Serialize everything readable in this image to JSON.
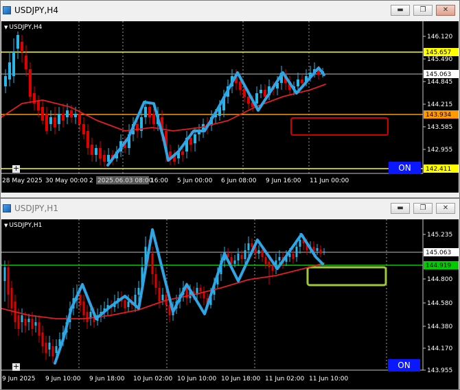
{
  "colors": {
    "bull": "#29b6e8",
    "bear": "#e00000",
    "ma": "#e02020",
    "zigzag": "#2ea6e6",
    "grid": "#c8c8c8",
    "h_yellow": "#ffff00",
    "h_orange": "#ff9900",
    "h_green": "#00cc00",
    "red_box": "#d00000",
    "green_box": "#9ec93c",
    "on_button": "#0b18ff"
  },
  "window_h4": {
    "title": "USDJPY,H4",
    "symbol_label": "USDJPY,H4",
    "on_label": "ON",
    "price_labels": [
      "146.120",
      "145.490",
      "144.845",
      "144.215",
      "143.585",
      "142.955"
    ],
    "marked_prices": [
      {
        "value": "145.657",
        "color": "#ffff00"
      },
      {
        "value": "145.063",
        "color": "#ffffff"
      },
      {
        "value": "143.934",
        "color": "#ff9900"
      },
      {
        "value": "142.411",
        "color": "#ffff00"
      }
    ],
    "time_labels": [
      "28 May 2025",
      "30 May 00:00",
      "2",
      "2025.06.03 08:00",
      "16:00",
      "5 Jun 00:00",
      "6 Jun 08:00",
      "9 Jun 16:00",
      "11 Jun 00:00"
    ],
    "crosshair_time": "2025.06.03 08:00"
  },
  "window_h1": {
    "title": "USDJPY,H1",
    "symbol_label": "USDJPY,H1",
    "on_label": "ON",
    "price_labels": [
      "145.235",
      "144.800",
      "144.580",
      "144.380",
      "144.170",
      "143.955"
    ],
    "marked_prices": [
      {
        "value": "145.063",
        "color": "#ffffff"
      },
      {
        "value": "144.919",
        "color": "#00cc00"
      }
    ],
    "time_labels": [
      "9 Jun 2025",
      "9 Jun 10:00",
      "9 Jun 18:00",
      "10 Jun 02:00",
      "10 Jun 10:00",
      "10 Jun 18:00",
      "11 Jun 02:00",
      "11 Jun 10:00"
    ]
  }
}
